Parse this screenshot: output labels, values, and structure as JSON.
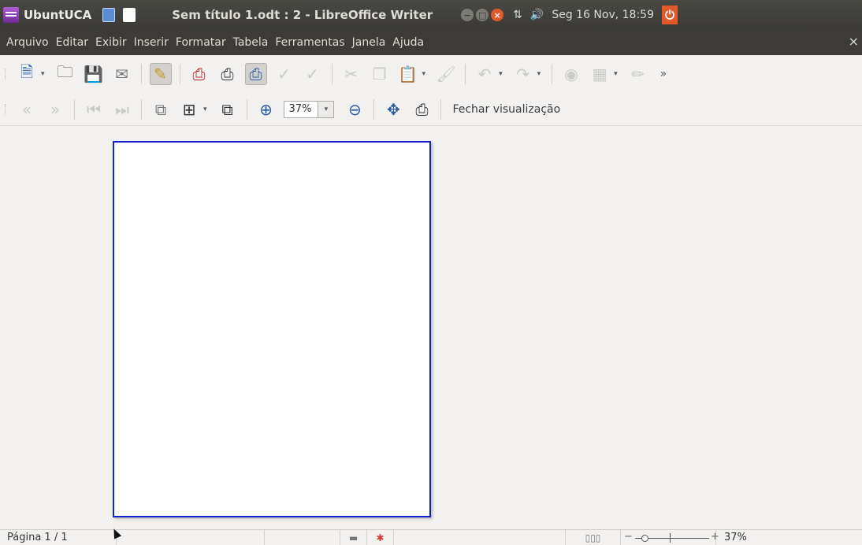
{
  "top_panel": {
    "launcher_label": "UbuntUCA",
    "window_title": "Sem título 1.odt : 2 - LibreOffice Writer",
    "window_buttons": [
      "minimize",
      "maximize",
      "close"
    ],
    "network_icon": "network-transfer-icon",
    "volume_icon": "volume-icon",
    "clock": "Seg 16 Nov, 18:59",
    "power_icon": "power-icon"
  },
  "menubar": {
    "items": [
      "Arquivo",
      "Editar",
      "Exibir",
      "Inserir",
      "Formatar",
      "Tabela",
      "Ferramentas",
      "Janela",
      "Ajuda"
    ],
    "close_glyph": "×"
  },
  "toolbar_standard": {
    "items": [
      {
        "icon": "new-document-icon",
        "enabled": true
      },
      {
        "icon": "open-icon",
        "enabled": true
      },
      {
        "icon": "save-icon",
        "enabled": true
      },
      {
        "icon": "email-icon",
        "enabled": true
      },
      {
        "icon": "edit-mode-icon",
        "enabled": true,
        "pressed": true
      },
      {
        "icon": "export-pdf-icon",
        "enabled": true
      },
      {
        "icon": "print-icon",
        "enabled": true
      },
      {
        "icon": "print-preview-icon",
        "enabled": true,
        "pressed": true
      },
      {
        "icon": "spellcheck-icon",
        "enabled": false
      },
      {
        "icon": "autospellcheck-icon",
        "enabled": false
      },
      {
        "icon": "cut-icon",
        "enabled": false
      },
      {
        "icon": "copy-icon",
        "enabled": false
      },
      {
        "icon": "paste-icon",
        "enabled": false
      },
      {
        "icon": "clone-formatting-icon",
        "enabled": false
      },
      {
        "icon": "undo-icon",
        "enabled": false
      },
      {
        "icon": "redo-icon",
        "enabled": false
      },
      {
        "icon": "navigator-icon",
        "enabled": false
      },
      {
        "icon": "table-icon",
        "enabled": false
      },
      {
        "icon": "draw-functions-icon",
        "enabled": false
      }
    ],
    "overflow_glyph": "»"
  },
  "toolbar_preview": {
    "zoom_value": "37%",
    "close_preview_label": "Fechar visualização"
  },
  "statusbar": {
    "page_info": "Página 1 / 1",
    "zoom_percent": "37%",
    "zoom_minus": "−",
    "zoom_plus": "+"
  }
}
